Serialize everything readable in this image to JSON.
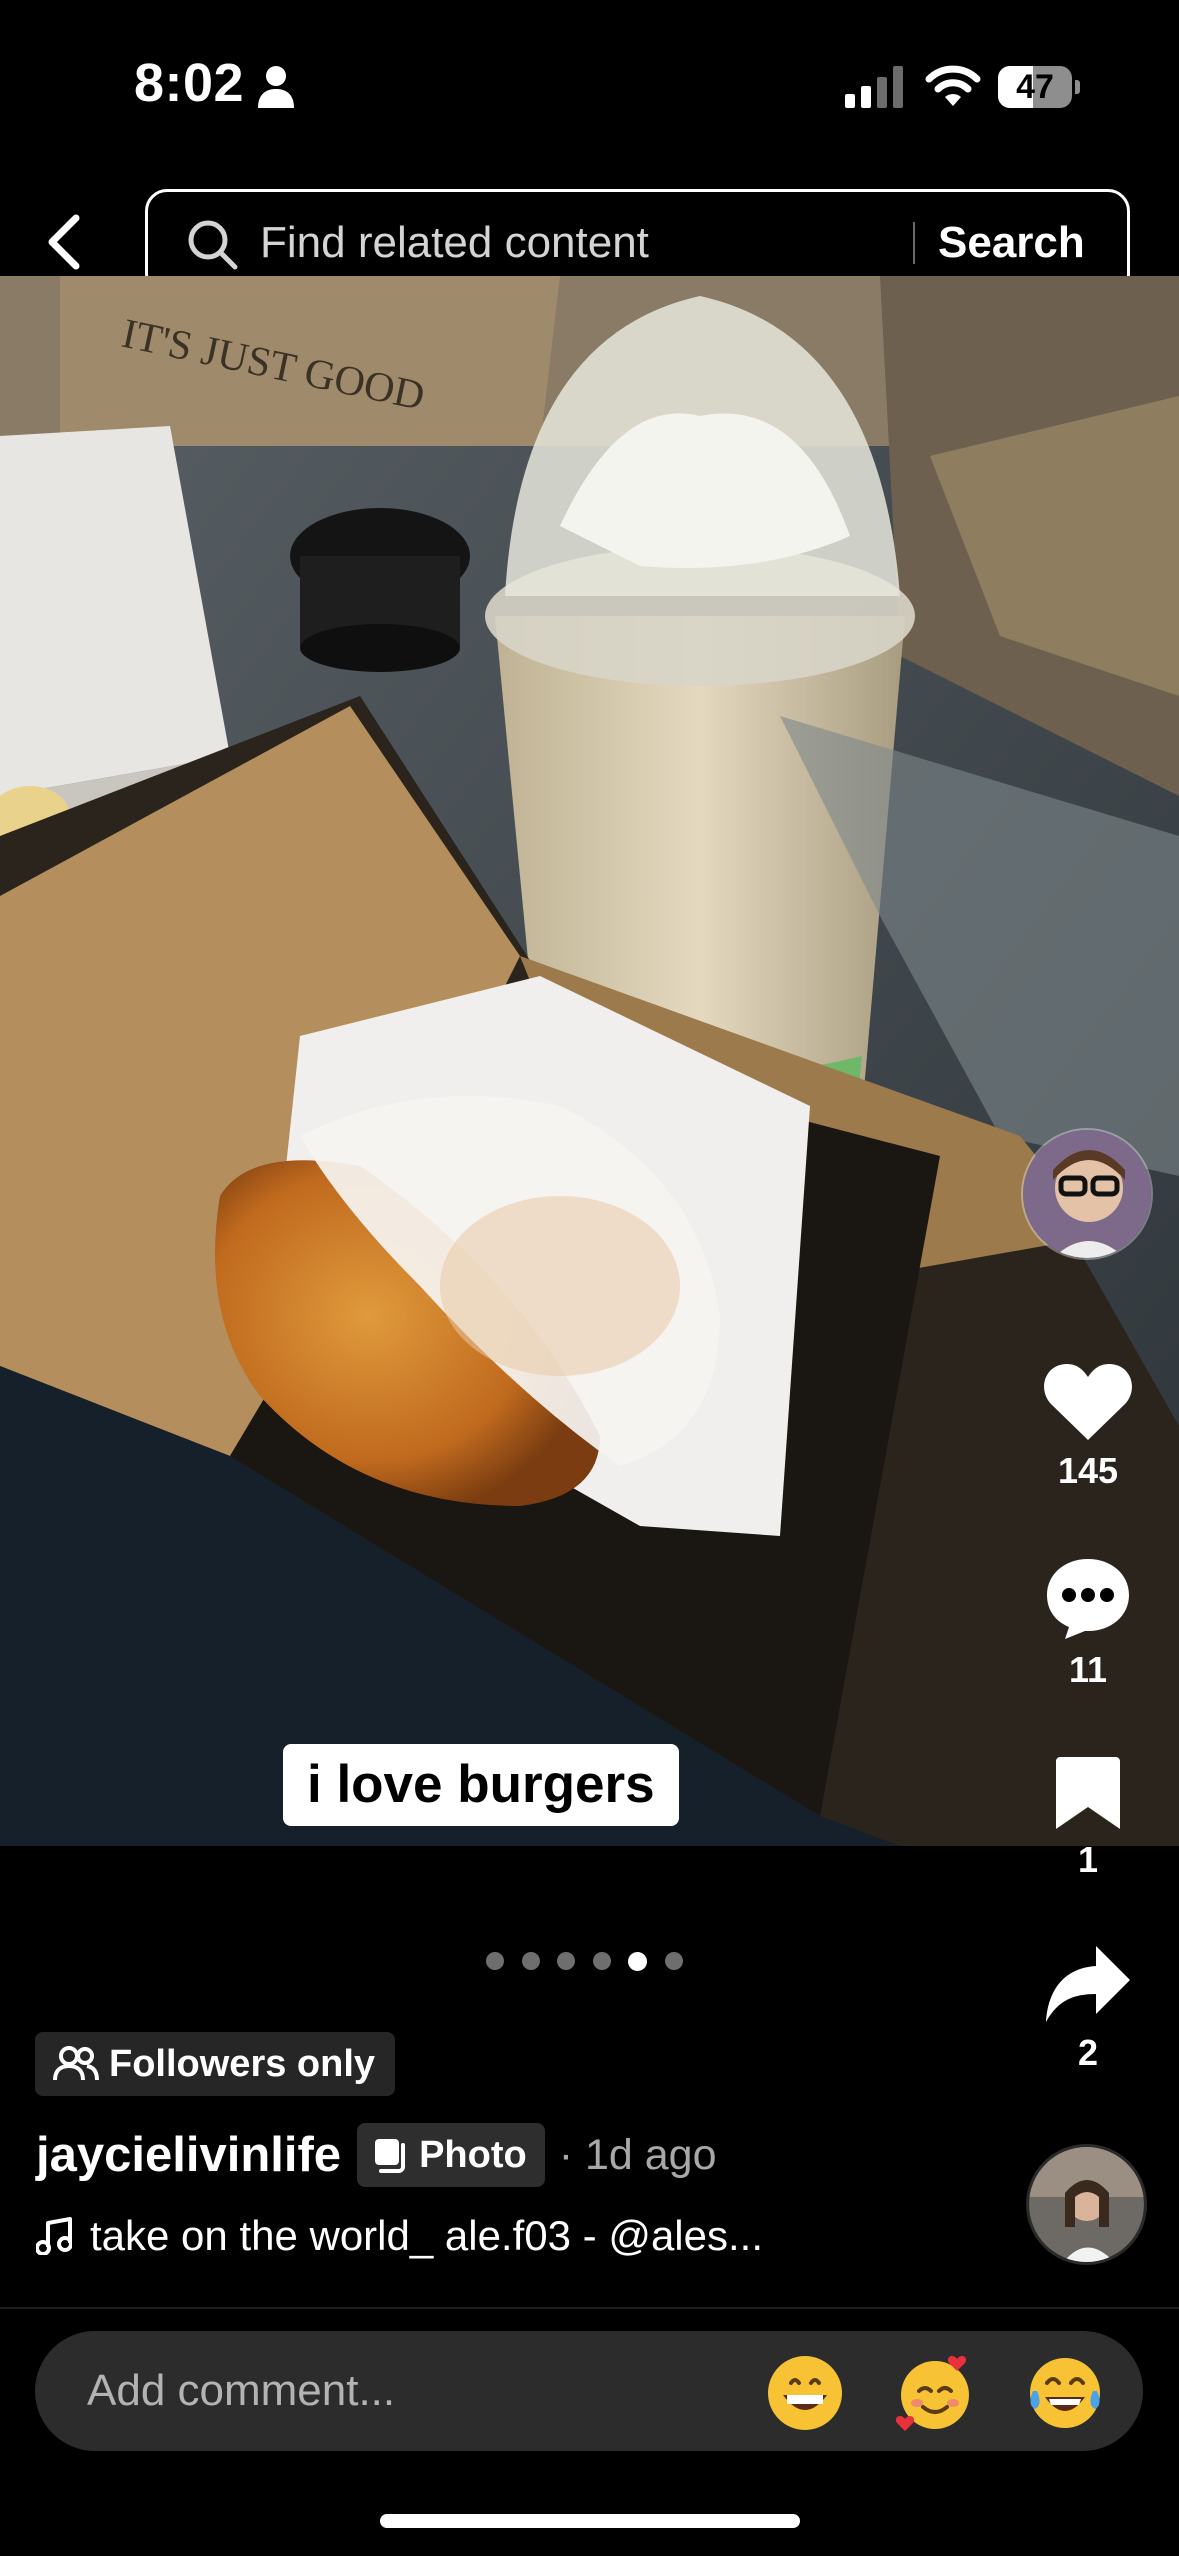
{
  "status_bar": {
    "time": "8:02",
    "battery_percent": 47,
    "battery_label": "47",
    "icons": [
      "person-icon",
      "cellular-signal-icon",
      "wifi-icon",
      "battery-icon"
    ]
  },
  "search": {
    "placeholder": "Find related content",
    "button_label": "Search",
    "icons": [
      "back-chevron-icon",
      "search-icon"
    ]
  },
  "post": {
    "caption_sticker": "i love burgers",
    "actions": {
      "likes": "145",
      "comments": "11",
      "saves": "1",
      "shares": "2"
    },
    "carousel": {
      "total": 6,
      "active_index": 4
    },
    "visibility_badge": "Followers only",
    "author": "jaycielivinlife",
    "type_tag": "Photo",
    "time_ago": "· 1d ago",
    "music": "take on the world_ ale.f03 - @ales..."
  },
  "comment_bar": {
    "placeholder": "Add comment...",
    "emojis": [
      "😁",
      "🥰",
      "😂"
    ]
  },
  "colors": {
    "background": "#000000",
    "badge_bg": "#262626",
    "comment_bar_bg": "#2c2c2c",
    "muted_text": "#a8a8a8"
  }
}
